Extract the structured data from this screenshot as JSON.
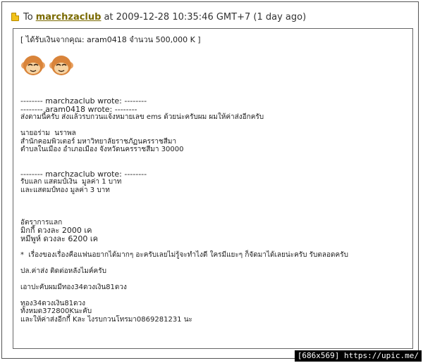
{
  "header": {
    "to_label": "To",
    "recipient": "marchzaclub",
    "timestamp": "at 2009-12-28 10:35:46 GMT+7 (1 day ago)"
  },
  "message": {
    "transfer_line": "[ ได้รับเงินจากคุณ: aram0418 จำนวน 500,000 K ]",
    "quote1": "-------- marchzaclub wrote: --------",
    "quote2": "-------- aram0418 wrote: --------",
    "line_shipping": "ส่งตามนี้ครับ ส่งแล้วรบกวนแจ้งหมายเลข ems ด้วยน่ะครับผม ผมให้ค่าส่งอีกครับ",
    "addr1": "นายอร่าม  นราพล",
    "addr2": "สำนักคอมพิวเตอร์ มหาวิทยาลัยราชภัฏนครราชสีมา",
    "addr3": "ตำบลในเมือง อำเภอเมือง จังหวัดนครราชสีมา 30000",
    "quote3": "-------- marchzaclub wrote: --------",
    "price1": "รับแลก แสตมป์เงิน  มูลค่า 1 บาท",
    "price2": "และแสตมป์ทอง มูลค่า 3 บาท",
    "rate_title": "อัตราการแลก",
    "rate1": "มิกกี้ ดวงละ 2000 เค",
    "rate2": "หมีพูห์ ดวงละ 6200 เค",
    "note": "*  เรื่องของเรื่องคือแฟนอยากได้มากๆ อะครับเลยไม่รู้จะทำไงดี ใครมีแยะๆ ก็จัดมาได้เลยน่ะครับ รับตลอดครับ",
    "ps": "ปล.ค่าส่ง ติดต่อหลังไมค์ครับ",
    "want": "เอาปะคับผมมีทอง34ดวงเงิน81ดวง",
    "sum1": "ทอง34ดวงเงิน81ดวง",
    "sum2": "ทั้งหมด372800Kนะคับ",
    "sum3": "และให้ค่าส่งอีกกี้ Kละ ไงรบกวนโทรมา0869281231 นะ"
  },
  "watermark": "[686x569] https://upic.me/"
}
